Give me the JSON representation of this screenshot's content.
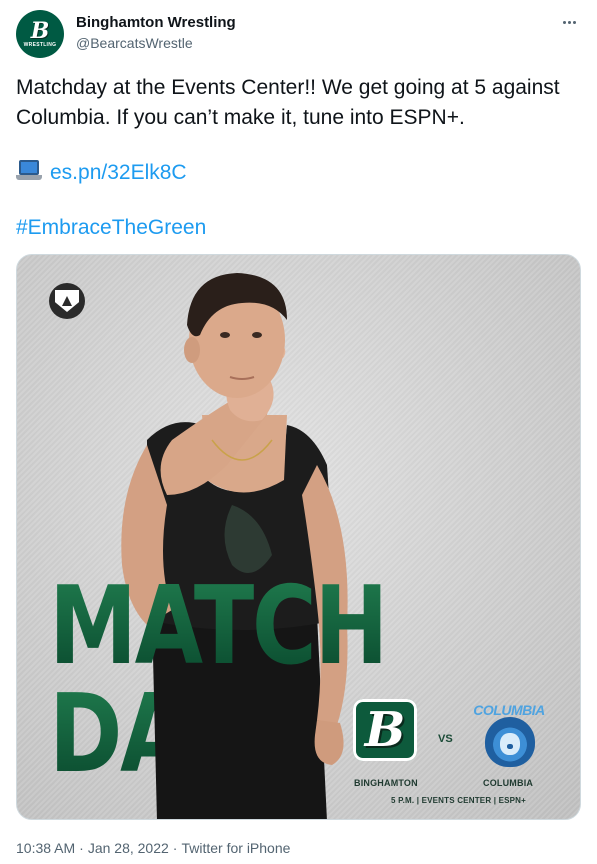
{
  "account": {
    "display_name": "Binghamton Wrestling",
    "handle": "@BearcatsWrestle",
    "avatar_letter": "B",
    "avatar_caption": "WRESTLING"
  },
  "tweet": {
    "text": "Matchday at the Events Center!! We get going at 5 against Columbia. If you can’t make it, tune into ESPN+.",
    "link_text": "es.pn/32Elk8C",
    "link_icon": "laptop-icon",
    "hashtag": "#EmbraceTheGreen"
  },
  "media": {
    "headline_line1": "MATCH",
    "headline_line2": "DAY",
    "home_logo_letter": "B",
    "vs": "VS",
    "away_logo_word": "COLUMBIA",
    "home_name": "BINGHAMTON",
    "away_name": "COLUMBIA",
    "details": "5 P.M. | EVENTS CENTER | ESPN+"
  },
  "meta": {
    "time": "10:38 AM",
    "date": "Jan 28, 2022",
    "source": "Twitter for iPhone"
  },
  "colors": {
    "brand_green": "#005a43",
    "link_blue": "#1d9bf0",
    "muted_text": "#536471",
    "columbia_blue": "#3d8fd6"
  }
}
